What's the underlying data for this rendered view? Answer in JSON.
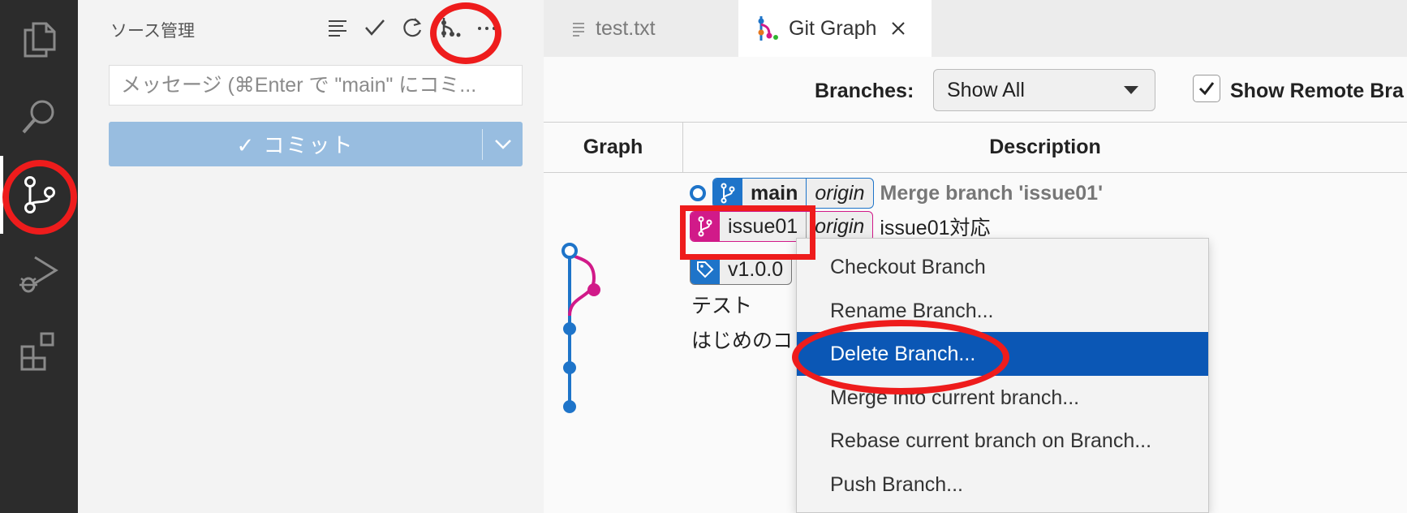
{
  "activity_bar": {
    "items": [
      {
        "icon": "files-icon"
      },
      {
        "icon": "search-icon"
      },
      {
        "icon": "source-control-icon",
        "active": true
      },
      {
        "icon": "run-debug-icon"
      },
      {
        "icon": "extensions-icon"
      }
    ]
  },
  "source_control": {
    "title": "ソース管理",
    "toolbar": [
      "view-as-list-icon",
      "commit-check-icon",
      "refresh-icon",
      "git-graph-icon",
      "more-actions-icon"
    ],
    "message_placeholder": "メッセージ (⌘Enter で \"main\" にコミ...",
    "commit_label": "✓ コミット"
  },
  "tabs": [
    {
      "label": "test.txt",
      "active": false
    },
    {
      "label": "Git Graph",
      "active": true
    }
  ],
  "git_graph": {
    "branches_label": "Branches:",
    "branches_value": "Show All",
    "show_remote_label": "Show Remote Bra",
    "show_remote_checked": true,
    "col_graph": "Graph",
    "col_description": "Description",
    "commits": [
      {
        "refs": [
          {
            "kind": "branch",
            "name": "main",
            "remote": "origin",
            "color": "#1e74c9"
          }
        ],
        "message": "Merge branch 'issue01'",
        "head": true
      },
      {
        "refs": [
          {
            "kind": "branch",
            "name": "issue01",
            "remote": "origin",
            "color": "#d11a89"
          }
        ],
        "message": "issue01対応"
      },
      {
        "refs": [
          {
            "kind": "tag",
            "name": "v1.0.0"
          }
        ],
        "message": ""
      },
      {
        "refs": [],
        "message": "テスト"
      },
      {
        "refs": [],
        "message": "はじめのコ"
      }
    ]
  },
  "context_menu": {
    "items": [
      {
        "label": "Checkout Branch"
      },
      {
        "label": "Rename Branch..."
      },
      {
        "label": "Delete Branch...",
        "selected": true
      },
      {
        "label": "Merge into current branch..."
      },
      {
        "label": "Rebase current branch on Branch..."
      },
      {
        "label": "Push Branch..."
      }
    ]
  },
  "colors": {
    "accent_blue": "#1e74c9",
    "branch_pink": "#d11a89",
    "menu_selected": "#0b57b5",
    "annotation_red": "#ee1c1c"
  }
}
